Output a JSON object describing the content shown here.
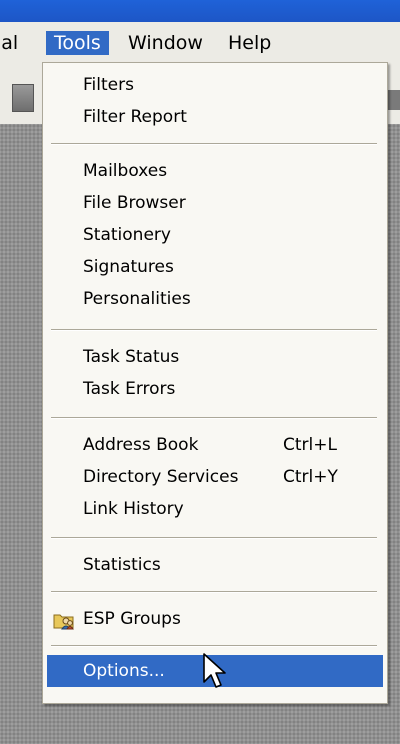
{
  "menubar": {
    "partial_label": "ial",
    "tools_label": "Tools",
    "window_label": "Window",
    "help_label": "Help"
  },
  "menu": {
    "filters": "Filters",
    "filter_report": "Filter Report",
    "mailboxes": "Mailboxes",
    "file_browser": "File Browser",
    "stationery": "Stationery",
    "signatures": "Signatures",
    "personalities": "Personalities",
    "task_status": "Task Status",
    "task_errors": "Task Errors",
    "address_book": "Address Book",
    "address_book_shortcut": "Ctrl+L",
    "directory_services": "Directory Services",
    "directory_services_shortcut": "Ctrl+Y",
    "link_history": "Link History",
    "statistics": "Statistics",
    "esp_groups": "ESP Groups",
    "options": "Options..."
  },
  "colors": {
    "highlight": "#316ac5",
    "menu_background": "#f9f8f3",
    "title_bar": "#1f62d8"
  },
  "icons": {
    "esp_groups": "folder-people-icon",
    "pointer": "mouse-pointer-icon"
  }
}
